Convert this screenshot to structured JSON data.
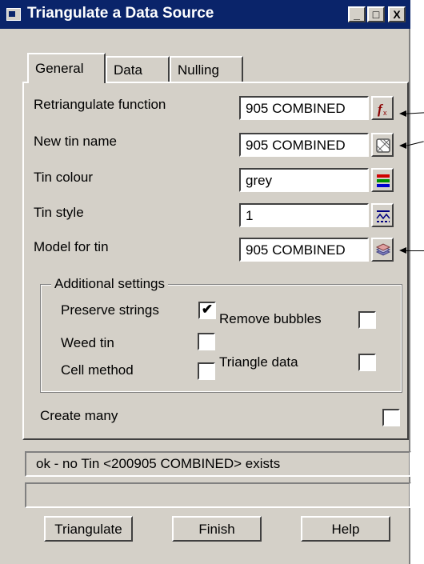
{
  "window": {
    "title": "Triangulate a Data Source"
  },
  "titlebar_buttons": {
    "minimize": "_",
    "maximize": "□",
    "close": "X"
  },
  "tabs": [
    {
      "label": "General"
    },
    {
      "label": "Data"
    },
    {
      "label": "Nulling"
    }
  ],
  "fields": {
    "retriangulate": {
      "label": "Retriangulate function",
      "value": "905 COMBINED"
    },
    "new_tin_name": {
      "label": "New tin name",
      "value": "905 COMBINED"
    },
    "tin_colour": {
      "label": "Tin colour",
      "value": "grey"
    },
    "tin_style": {
      "label": "Tin style",
      "value": "1"
    },
    "model_for_tin": {
      "label": "Model for tin",
      "value": "905 COMBINED"
    }
  },
  "additional": {
    "legend": "Additional settings",
    "preserve_strings": {
      "label": "Preserve strings",
      "checked": true
    },
    "remove_bubbles": {
      "label": "Remove bubbles",
      "checked": false
    },
    "weed_tin": {
      "label": "Weed tin",
      "checked": false
    },
    "triangle_data": {
      "label": "Triangle data",
      "checked": false
    },
    "cell_method": {
      "label": "Cell method",
      "checked": false
    }
  },
  "create_many": {
    "label": "Create many",
    "checked": false
  },
  "checkmark": "✔",
  "status": {
    "message": "ok - no Tin <200905 COMBINED> exists",
    "secondary": ""
  },
  "buttons": {
    "triangulate": "Triangulate",
    "finish": "Finish",
    "help": "Help"
  }
}
